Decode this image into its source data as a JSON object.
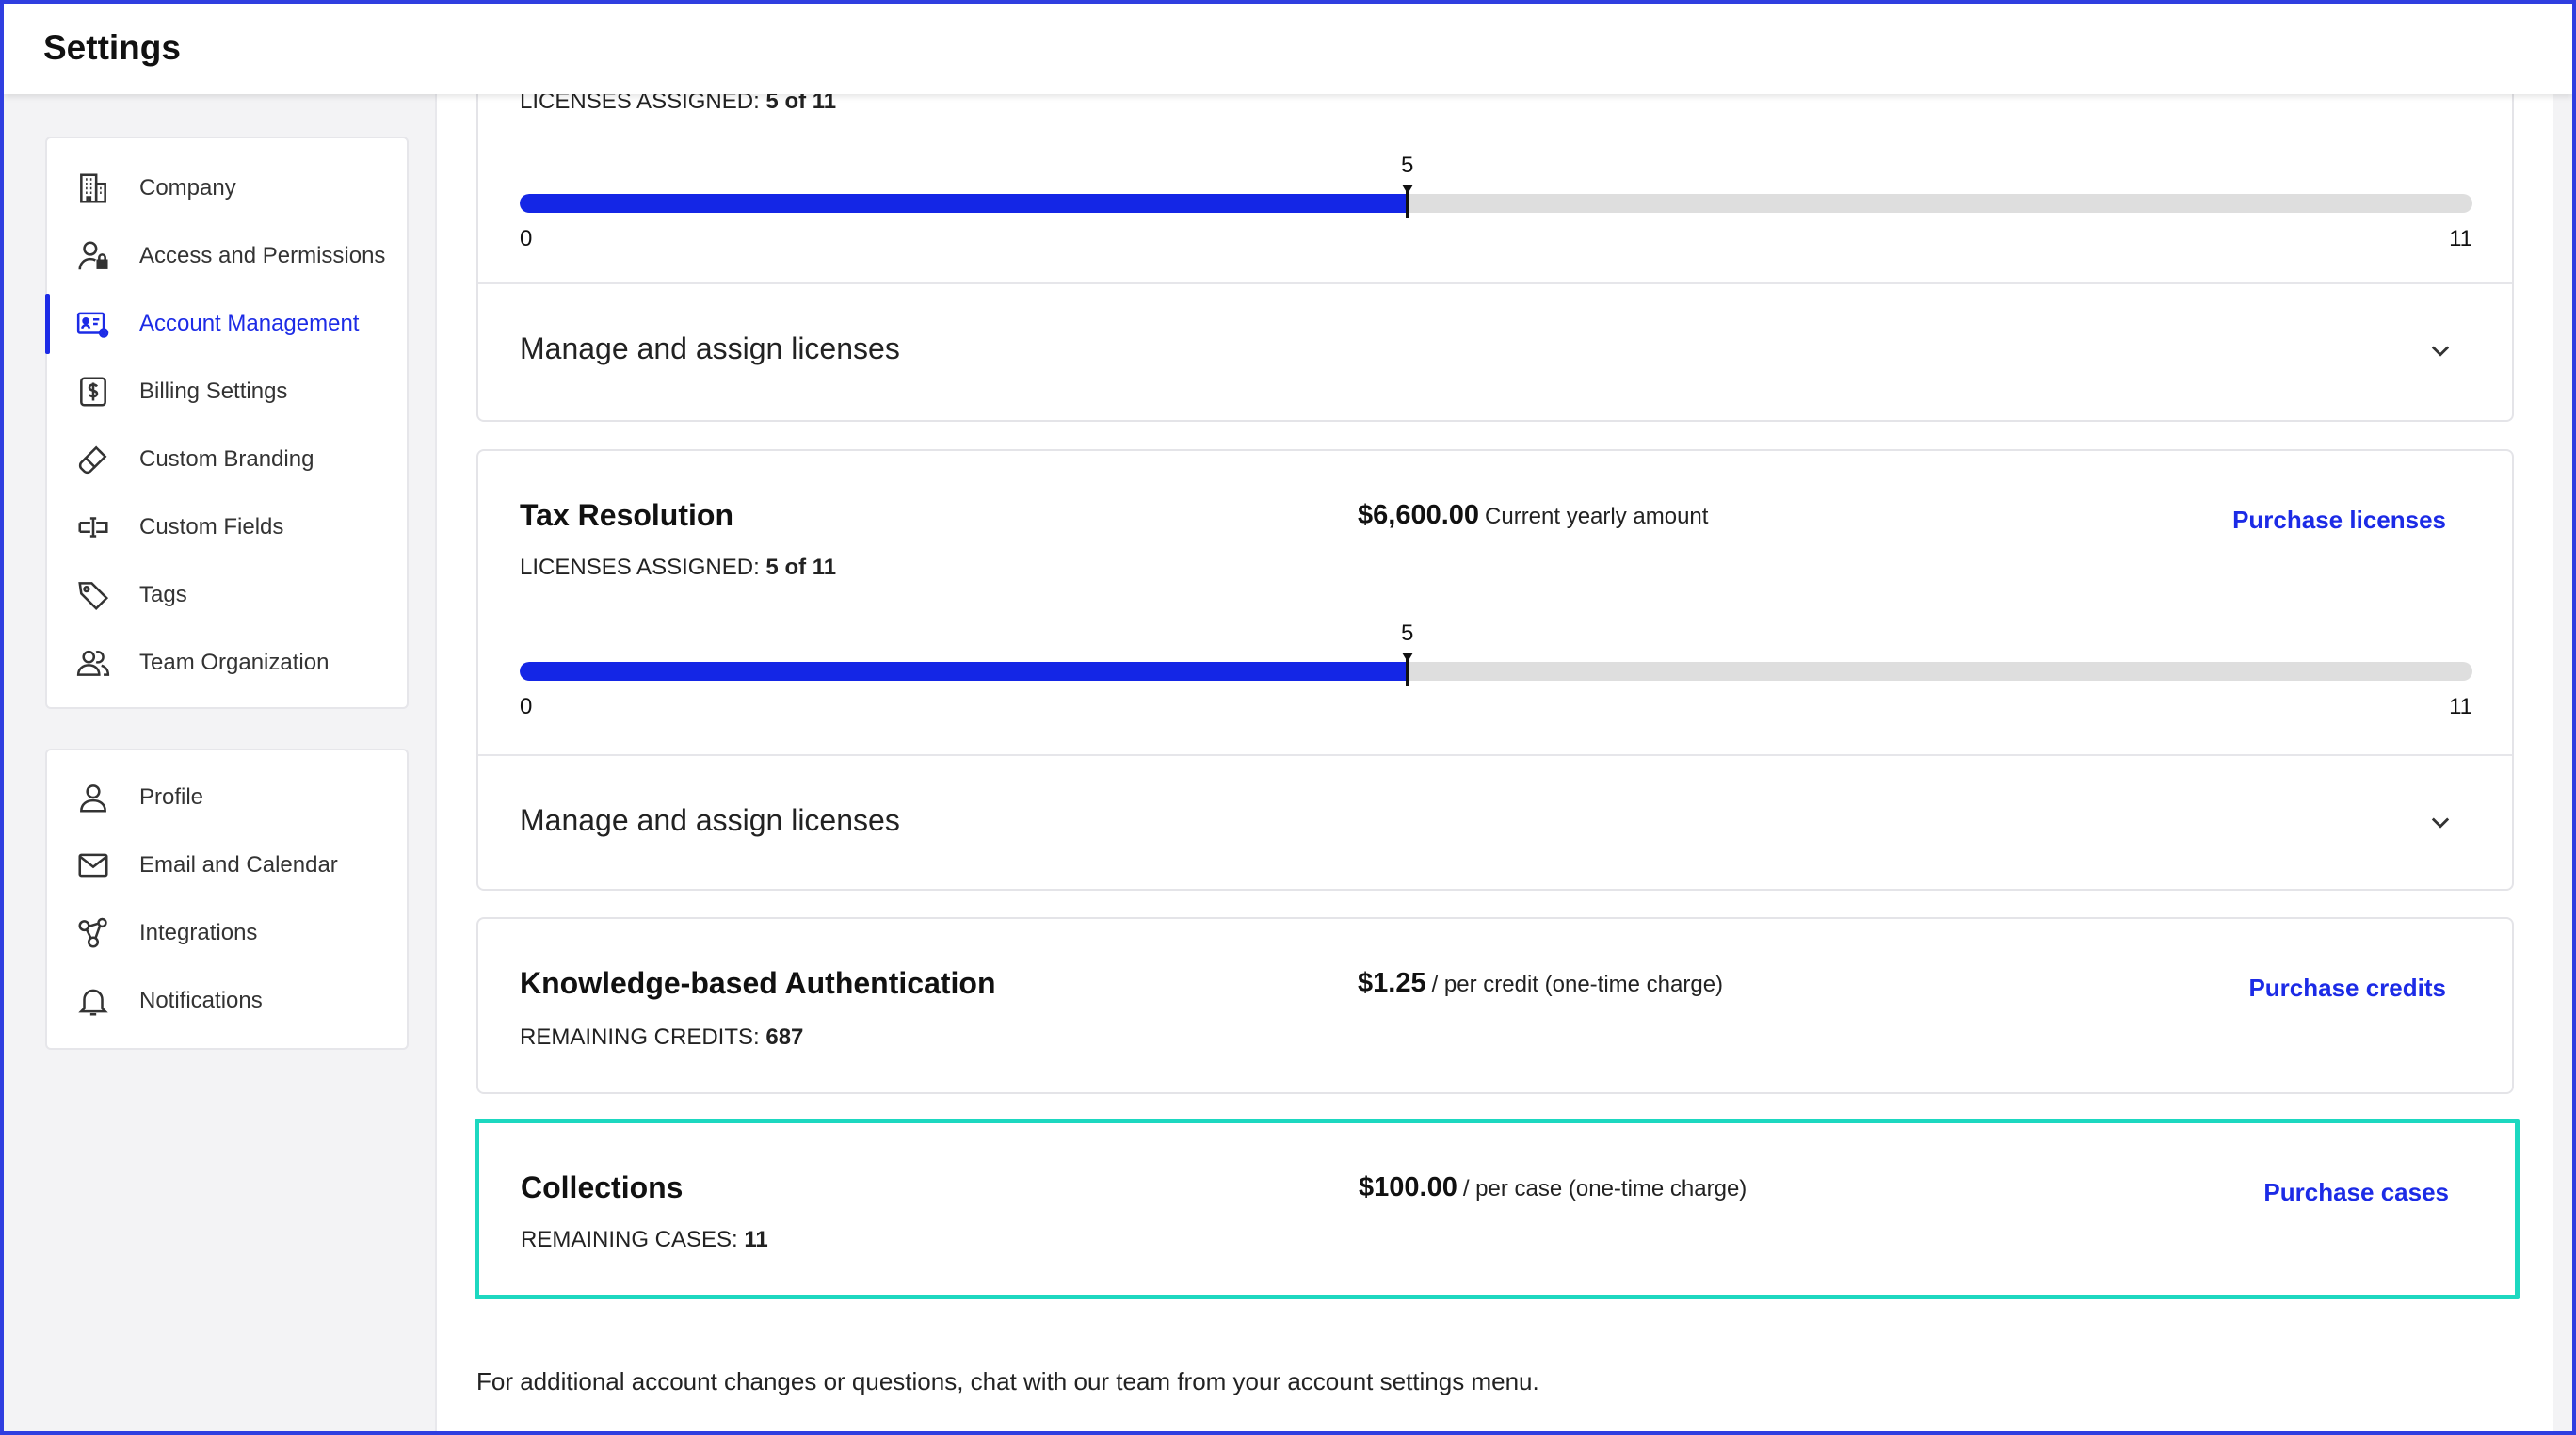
{
  "header": {
    "title": "Settings"
  },
  "sidebar": {
    "top_items": [
      {
        "label": "Company",
        "icon": "building-icon"
      },
      {
        "label": "Access and Permissions",
        "icon": "user-lock-icon"
      },
      {
        "label": "Account Management",
        "icon": "account-card-gear-icon",
        "active": true
      },
      {
        "label": "Billing Settings",
        "icon": "dollar-icon"
      },
      {
        "label": "Custom Branding",
        "icon": "brush-icon"
      },
      {
        "label": "Custom Fields",
        "icon": "text-field-icon"
      },
      {
        "label": "Tags",
        "icon": "tag-icon"
      },
      {
        "label": "Team Organization",
        "icon": "team-icon"
      }
    ],
    "bottom_items": [
      {
        "label": "Profile",
        "icon": "user-icon"
      },
      {
        "label": "Email and Calendar",
        "icon": "mail-icon"
      },
      {
        "label": "Integrations",
        "icon": "share-nodes-icon"
      },
      {
        "label": "Notifications",
        "icon": "bell-icon"
      }
    ]
  },
  "cards": {
    "first": {
      "licenses_prefix": "LICENSES ASSIGNED: ",
      "licenses_value": "5 of 11",
      "progress": {
        "value": 5,
        "min": 0,
        "max": 11,
        "value_label": "5",
        "min_label": "0",
        "max_label": "11"
      },
      "accordion_label": "Manage and assign licenses"
    },
    "tax": {
      "title": "Tax Resolution",
      "amount": "$6,600.00",
      "amount_note": "Current yearly amount",
      "action": "Purchase licenses",
      "licenses_prefix": "LICENSES ASSIGNED: ",
      "licenses_value": "5 of 11",
      "progress": {
        "value": 5,
        "min": 0,
        "max": 11,
        "value_label": "5",
        "min_label": "0",
        "max_label": "11"
      },
      "accordion_label": "Manage and assign licenses"
    },
    "kba": {
      "title": "Knowledge-based Authentication",
      "amount": "$1.25",
      "amount_note": "/ per credit (one-time charge)",
      "action": "Purchase credits",
      "remaining_prefix": "REMAINING CREDITS: ",
      "remaining_value": "687"
    },
    "collections": {
      "title": "Collections",
      "amount": "$100.00",
      "amount_note": "/ per case (one-time charge)",
      "action": "Purchase cases",
      "remaining_prefix": "REMAINING CASES: ",
      "remaining_value": "11"
    }
  },
  "footer_note": "For additional account changes or questions, chat with our team from your account settings menu.",
  "colors": {
    "accent": "#1c2be6",
    "highlight": "#1dd8c0",
    "frame": "#2f3ee0"
  }
}
